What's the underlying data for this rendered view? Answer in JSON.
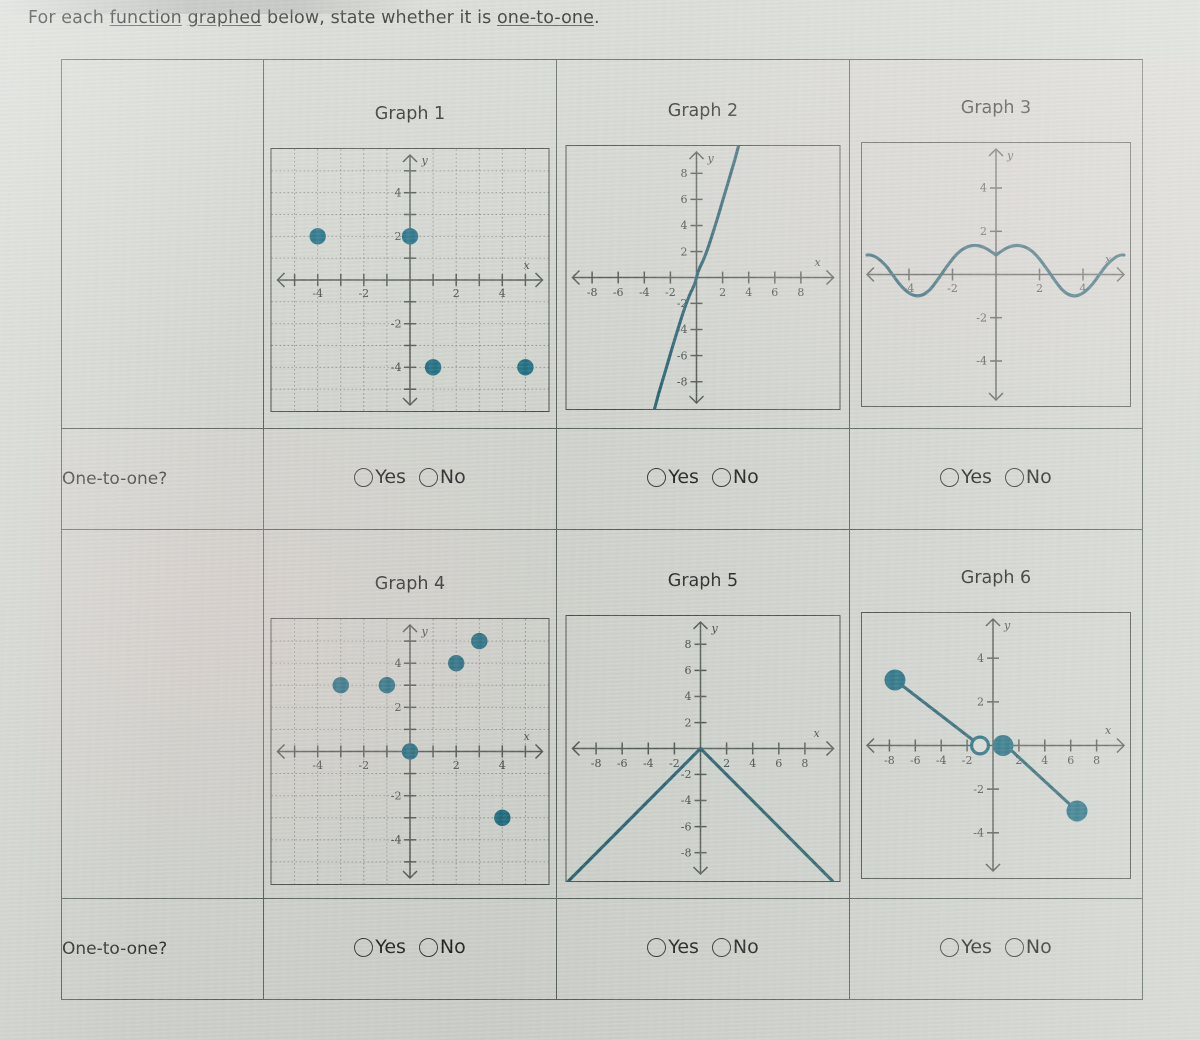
{
  "prompt": {
    "part1": "For each ",
    "link1": "function",
    "part2": " ",
    "link2": "graphed",
    "part3": " below, state whether it is ",
    "link3": "one-to-one",
    "part4": "."
  },
  "table": {
    "row_label": "One-to-one?",
    "answer_options": [
      "Yes",
      "No"
    ],
    "graph_titles": [
      "Graph 1",
      "Graph 2",
      "Graph 3",
      "Graph 4",
      "Graph 5",
      "Graph 6"
    ]
  },
  "colors": {
    "curve": "#1d5d6c",
    "point": "#14697e",
    "axis": "#4a534c",
    "border": "#4e5952",
    "page_background": "#d5d9d2"
  },
  "chart_data": [
    {
      "id": "graph1",
      "type": "scatter",
      "title": "Graph 1",
      "xlabel": "x",
      "ylabel": "y",
      "xlim": [
        -6,
        6
      ],
      "ylim": [
        -6,
        6
      ],
      "grid": true,
      "xticks": [
        -4,
        -2,
        2,
        4
      ],
      "yticks": [
        4,
        2,
        -2,
        -4
      ],
      "xtick_labels": [
        "-4",
        "-2",
        "2",
        "4"
      ],
      "ytick_labels": [
        "4",
        "2",
        "-2",
        "-4"
      ],
      "points": [
        {
          "x": -4,
          "y": 2
        },
        {
          "x": 0,
          "y": 2
        },
        {
          "x": 1,
          "y": -4
        },
        {
          "x": 5,
          "y": -4
        }
      ]
    },
    {
      "id": "graph2",
      "type": "line",
      "title": "Graph 2",
      "xlabel": "x",
      "ylabel": "y",
      "xlim": [
        -10,
        10
      ],
      "ylim": [
        -10,
        10
      ],
      "grid": false,
      "xticks": [
        -8,
        -6,
        -4,
        -2,
        2,
        4,
        6,
        8
      ],
      "yticks": [
        8,
        6,
        4,
        2,
        -2,
        -4,
        -6,
        -8
      ],
      "xtick_labels": [
        "-8",
        "-6",
        "-4",
        "-2",
        "2",
        "4",
        "6",
        "8"
      ],
      "ytick_labels": [
        "8",
        "6",
        "4",
        "2",
        "-2",
        "-4",
        "-6",
        "-8"
      ],
      "description": "increasing cubic-like curve passing through origin",
      "x": [
        -3.2,
        -3.0,
        -2.6,
        -2.2,
        -1.8,
        -1.4,
        -1.0,
        -0.6,
        -0.2,
        0,
        0.2,
        0.6,
        1.0,
        1.4,
        1.8,
        2.2,
        2.6,
        3.0,
        3.3
      ],
      "y": [
        -11.5,
        -9.6,
        -7.2,
        -5.3,
        -3.7,
        -2.3,
        -1.1,
        -0.35,
        -0.05,
        0,
        0.05,
        0.35,
        1.1,
        2.3,
        3.7,
        5.3,
        7.2,
        9.6,
        11.5
      ]
    },
    {
      "id": "graph3",
      "type": "line",
      "title": "Graph 3",
      "xlabel": "x",
      "ylabel": "y",
      "xlim": [
        -6,
        6
      ],
      "ylim": [
        -6,
        6
      ],
      "grid": false,
      "xticks": [
        -4,
        -2,
        2,
        4
      ],
      "yticks": [
        4,
        2,
        -2,
        -4
      ],
      "xtick_labels": [
        "-4",
        "-2",
        "2",
        "4"
      ],
      "ytick_labels": [
        "4",
        "2",
        "-2",
        "-4"
      ],
      "description": "cosine wave, amplitude about 0.9, period about 6",
      "amplitude": 0.9,
      "period": 6,
      "x": [
        -6,
        -5.5,
        -5,
        -4.5,
        -4,
        -3.5,
        -3,
        -2.5,
        -2,
        -1.5,
        -1,
        -0.5,
        0,
        0.5,
        1,
        1.5,
        2,
        2.5,
        3,
        3.5,
        4,
        4.5,
        5,
        5.5,
        6
      ],
      "y": [
        0.9,
        0.78,
        0.45,
        0.0,
        -0.45,
        -0.78,
        -0.9,
        -0.78,
        -0.45,
        0.0,
        0.45,
        0.78,
        0.9,
        0.78,
        0.45,
        0.0,
        -0.45,
        -0.78,
        -0.9,
        -0.78,
        -0.45,
        0.0,
        0.45,
        0.78,
        0.9
      ]
    },
    {
      "id": "graph4",
      "type": "scatter",
      "title": "Graph 4",
      "xlabel": "x",
      "ylabel": "y",
      "xlim": [
        -6,
        6
      ],
      "ylim": [
        -6,
        6
      ],
      "grid": true,
      "xticks": [
        -4,
        -2,
        2,
        4
      ],
      "yticks": [
        4,
        2,
        -2,
        -4
      ],
      "xtick_labels": [
        "-4",
        "-2",
        "2",
        "4"
      ],
      "ytick_labels": [
        "4",
        "2",
        "-2",
        "-4"
      ],
      "points": [
        {
          "x": -3,
          "y": 3
        },
        {
          "x": -1,
          "y": 3
        },
        {
          "x": 0,
          "y": 0
        },
        {
          "x": 2,
          "y": 4
        },
        {
          "x": 3,
          "y": 5
        },
        {
          "x": 4,
          "y": -3
        }
      ]
    },
    {
      "id": "graph5",
      "type": "line",
      "title": "Graph 5",
      "xlabel": "x",
      "ylabel": "y",
      "xlim": [
        -10,
        10
      ],
      "ylim": [
        -10,
        10
      ],
      "grid": false,
      "xticks": [
        -8,
        -6,
        -4,
        -2,
        2,
        4,
        6,
        8
      ],
      "yticks": [
        8,
        6,
        4,
        2,
        -2,
        -4,
        -6,
        -8
      ],
      "xtick_labels": [
        "-8",
        "-6",
        "-4",
        "-2",
        "2",
        "4",
        "6",
        "8"
      ],
      "ytick_labels": [
        "8",
        "6",
        "4",
        "2",
        "-2",
        "-4",
        "-6",
        "-8"
      ],
      "description": "inverted V: y = -|x|, vertex at origin",
      "x": [
        -10.5,
        0,
        10.5
      ],
      "y": [
        -10.5,
        0,
        -10.5
      ]
    },
    {
      "id": "graph6",
      "type": "line",
      "title": "Graph 6",
      "xlabel": "x",
      "ylabel": "y",
      "xlim": [
        -10,
        10
      ],
      "ylim": [
        -10,
        10
      ],
      "grid": false,
      "xticks": [
        -8,
        -6,
        -4,
        -2,
        2,
        4,
        6,
        8
      ],
      "yticks": [
        4,
        2,
        -2,
        -4
      ],
      "xtick_labels": [
        "-8",
        "-6",
        "-4",
        "-2",
        "2",
        "4",
        "6",
        "8"
      ],
      "ytick_labels": [
        "4",
        "2",
        "-2",
        "-4"
      ],
      "description": "two decreasing segments",
      "segments": [
        {
          "from": {
            "x": -7.5,
            "y": 3
          },
          "to": {
            "x": -1,
            "y": 0
          },
          "start_marker": "closed",
          "end_marker": "open"
        },
        {
          "from": {
            "x": 0,
            "y": 0
          },
          "to": {
            "x": 6.5,
            "y": -3
          },
          "start_marker": "closed",
          "end_marker": "closed"
        }
      ]
    }
  ]
}
